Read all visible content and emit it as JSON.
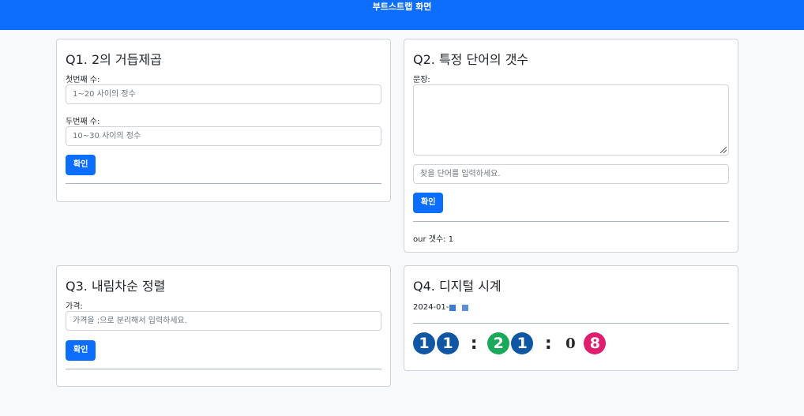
{
  "header": {
    "title": "부트스트랩 화면"
  },
  "q1": {
    "title": "Q1. 2의 거듭제곱",
    "first_label": "첫번째 수:",
    "first_placeholder": "1~20 사이의 정수",
    "second_label": "두번째 수:",
    "second_placeholder": "10~30 사이의 정수",
    "button": "확인"
  },
  "q2": {
    "title": "Q2. 특정 단어의 갯수",
    "sentence_label": "문장:",
    "sentence_value": "",
    "word_placeholder": "찾을 단어를 입력하세요.",
    "button": "확인",
    "result": "our 갯수: 1"
  },
  "q3": {
    "title": "Q3. 내림차순 정렬",
    "price_label": "가격:",
    "price_placeholder": "가격을 ;으로 분리해서 입력하세요.",
    "button": "확인"
  },
  "q4": {
    "title": "Q4. 디지털 시계",
    "date": "2024-01-",
    "clock": {
      "h1": "1",
      "h2": "1",
      "sep1": ":",
      "m1": "2",
      "m2": "1",
      "sep2": ":",
      "s1": "0",
      "s2": "8"
    },
    "colors": {
      "blue": "#0f56a5",
      "green": "#1aa85a",
      "pink": "#e01e6e"
    }
  },
  "colors": {
    "primary": "#0d6efd",
    "background": "#f8f9fa"
  }
}
